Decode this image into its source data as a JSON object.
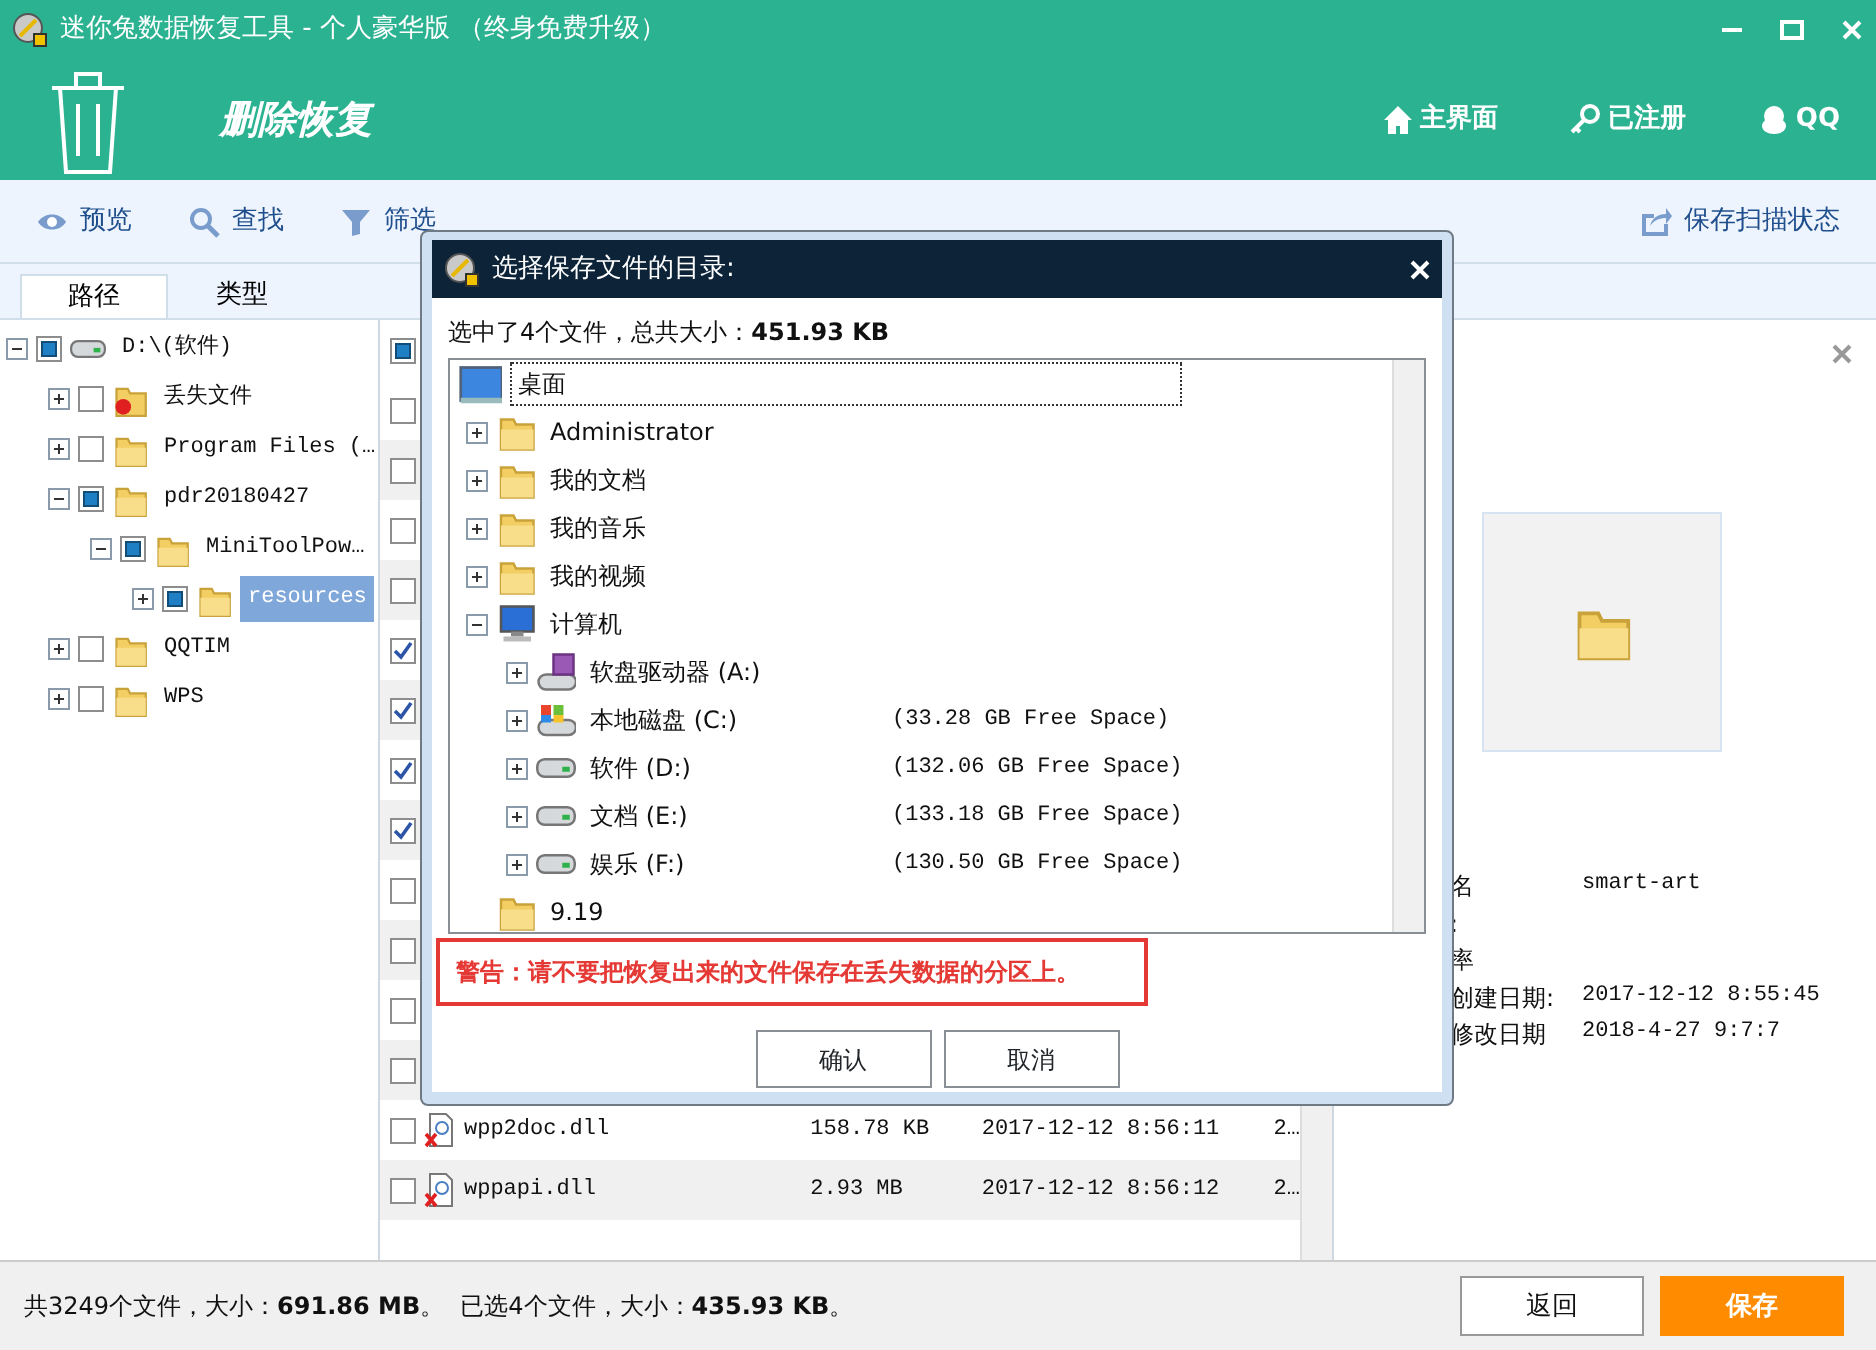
{
  "window": {
    "title": "迷你兔数据恢复工具 - 个人豪华版  （终身免费升级）"
  },
  "header": {
    "title": "删除恢复",
    "nav": [
      {
        "label": "主界面",
        "kind": "home"
      },
      {
        "label": "已注册",
        "kind": "key"
      },
      {
        "label": "QQ",
        "kind": "qq"
      }
    ]
  },
  "toolbar": {
    "items": [
      {
        "label": "预览",
        "kind": "eye"
      },
      {
        "label": "查找",
        "kind": "search"
      },
      {
        "label": "筛选",
        "kind": "filter"
      }
    ],
    "save_state": "保存扫描状态"
  },
  "tabs": [
    {
      "label": "路径",
      "selected": true
    },
    {
      "label": "类型",
      "selected": false
    }
  ],
  "tree": [
    {
      "label": "D:\\(软件)",
      "kind": "drive",
      "checked": false,
      "partial": true,
      "expanded": true,
      "selected": false,
      "children": [
        {
          "label": "丢失文件",
          "kind": "lost-folder",
          "checked": false,
          "partial": false,
          "expanded": false,
          "selected": false
        },
        {
          "label": "Program Files (…",
          "kind": "folder",
          "checked": false,
          "partial": false,
          "expanded": false,
          "selected": false
        },
        {
          "label": "pdr20180427",
          "kind": "folder",
          "checked": false,
          "partial": true,
          "expanded": true,
          "selected": false,
          "children": [
            {
              "label": "MiniToolPow…",
              "kind": "folder",
              "checked": false,
              "partial": true,
              "expanded": true,
              "selected": false,
              "children": [
                {
                  "label": "resources",
                  "kind": "folder",
                  "checked": false,
                  "partial": true,
                  "expanded": false,
                  "selected": true
                }
              ]
            }
          ]
        },
        {
          "label": "QQTIM",
          "kind": "folder",
          "checked": false,
          "partial": false,
          "expanded": false,
          "selected": false
        },
        {
          "label": "WPS",
          "kind": "folder",
          "checked": false,
          "partial": false,
          "expanded": false,
          "selected": false
        }
      ]
    }
  ],
  "file_list": {
    "header_checked": false,
    "header_partial": true,
    "rows": [
      {
        "checked": false
      },
      {
        "checked": false
      },
      {
        "checked": false
      },
      {
        "checked": false
      },
      {
        "checked": true
      },
      {
        "checked": true
      },
      {
        "checked": true
      },
      {
        "checked": true
      },
      {
        "checked": false
      },
      {
        "checked": false
      },
      {
        "checked": false
      },
      {
        "checked": false
      },
      {
        "checked": false,
        "name": "wpp2doc.dll",
        "size": "158.78 KB",
        "date": "2017-12-12 8:56:11",
        "column_4": "2…"
      },
      {
        "checked": false,
        "name": "wppapi.dll",
        "size": "2.93 MB",
        "date": "2017-12-12 8:56:12",
        "column_4": "2…"
      }
    ]
  },
  "details": {
    "rows": [
      {
        "label": "名",
        "value": "smart-art"
      },
      {
        "label": ":"
      },
      {
        "label": "率"
      },
      {
        "label": "创建日期:",
        "value": "2017-12-12 8:55:45"
      },
      {
        "label": "修改日期",
        "value": "2018-4-27 9:7:7"
      }
    ]
  },
  "status_bar": {
    "total": "共3249个文件，大小：**691.86 MB**。",
    "selected": "已选4个文件，大小：**435.93 KB**。",
    "buttons": [
      {
        "label": "返回",
        "kind": "secondary"
      },
      {
        "label": "保存",
        "kind": "primary"
      }
    ]
  },
  "dialog": {
    "title": "选择保存文件的目录:",
    "info": "选中了4个文件，总共大小：**451.93 KB**",
    "tree": [
      {
        "label": "桌面",
        "kind": "desktop",
        "selected": true,
        "children": [
          {
            "label": "Administrator",
            "kind": "folder",
            "expanded": false,
            "selected": false
          },
          {
            "label": "我的文档",
            "kind": "folder",
            "expanded": false,
            "selected": false
          },
          {
            "label": "我的音乐",
            "kind": "folder",
            "expanded": false,
            "selected": false
          },
          {
            "label": "我的视频",
            "kind": "folder",
            "expanded": false,
            "selected": false
          },
          {
            "label": "计算机",
            "kind": "computer",
            "expanded": true,
            "selected": false,
            "children": [
              {
                "label": "软盘驱动器 (A:)",
                "kind": "floppy",
                "expanded": false,
                "selected": false
              },
              {
                "label": "本地磁盘 (C:)",
                "kind": "system-drive",
                "expanded": false,
                "selected": false,
                "free": "(33.28 GB Free Space)"
              },
              {
                "label": "软件 (D:)",
                "kind": "drive",
                "expanded": false,
                "selected": false,
                "free": "(132.06 GB Free Space)"
              },
              {
                "label": "文档 (E:)",
                "kind": "drive",
                "expanded": false,
                "selected": false,
                "free": "(133.18 GB Free Space)"
              },
              {
                "label": "娱乐 (F:)",
                "kind": "drive",
                "expanded": false,
                "selected": false,
                "free": "(130.50 GB Free Space)"
              }
            ]
          },
          {
            "label": "9.19",
            "kind": "folder",
            "selected": false
          }
        ]
      }
    ],
    "warning": "警告：请不要把恢复出来的文件保存在丢失数据的分区上。",
    "buttons": [
      {
        "label": "确认"
      },
      {
        "label": "取消"
      }
    ]
  }
}
